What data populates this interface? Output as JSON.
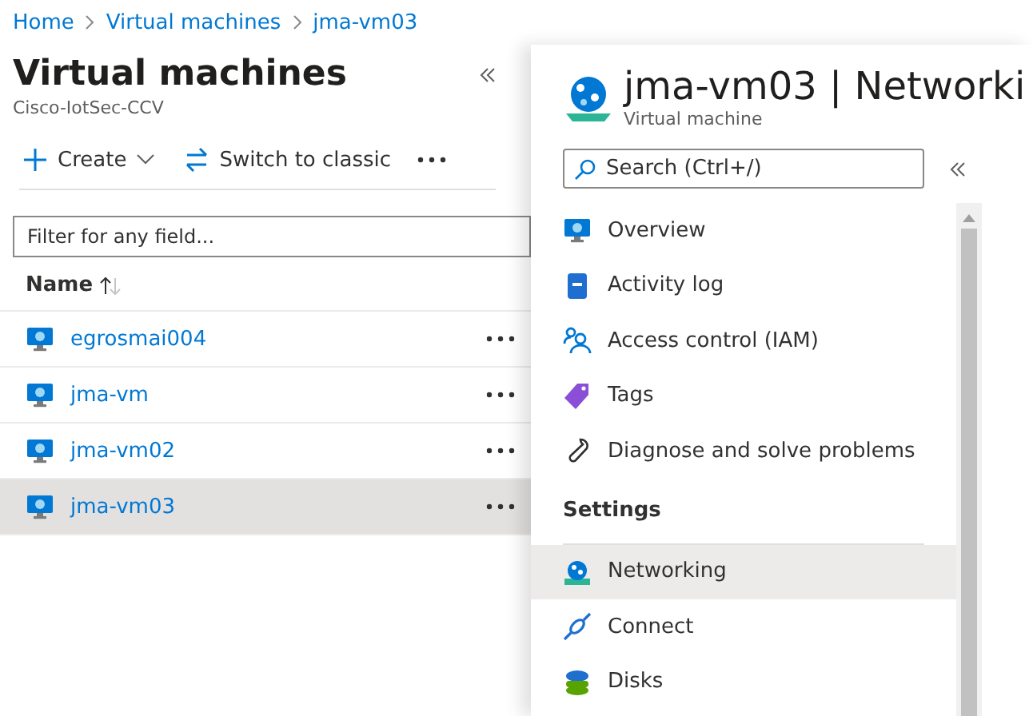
{
  "breadcrumb": [
    "Home",
    "Virtual machines",
    "jma-vm03"
  ],
  "list_blade": {
    "title": "Virtual machines",
    "subtitle": "Cisco-IotSec-CCV",
    "toolbar": [
      "Create",
      "Switch to classic"
    ],
    "filter": {
      "placeholder": "Filter for any field..."
    },
    "columns": [
      "Name"
    ],
    "rows": [
      {
        "name": "egrosmai004",
        "selected": false
      },
      {
        "name": "jma-vm",
        "selected": false
      },
      {
        "name": "jma-vm02",
        "selected": false
      },
      {
        "name": "jma-vm03",
        "selected": true
      }
    ]
  },
  "detail_blade": {
    "title": "jma-vm03 | Networki",
    "subtitle": "Virtual machine",
    "search": {
      "placeholder": "Search (Ctrl+/)"
    },
    "nav": [
      {
        "kind": "item",
        "label": "Overview",
        "selected": false
      },
      {
        "kind": "item",
        "label": "Activity log",
        "selected": false
      },
      {
        "kind": "item",
        "label": "Access control (IAM)",
        "selected": false
      },
      {
        "kind": "item",
        "label": "Tags",
        "selected": false
      },
      {
        "kind": "item",
        "label": "Diagnose and solve problems",
        "selected": false
      },
      {
        "kind": "section",
        "label": "Settings"
      },
      {
        "kind": "item",
        "label": "Networking",
        "selected": true
      },
      {
        "kind": "item",
        "label": "Connect",
        "selected": false
      },
      {
        "kind": "item",
        "label": "Disks",
        "selected": false
      }
    ]
  }
}
